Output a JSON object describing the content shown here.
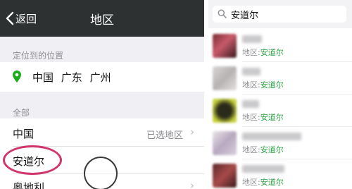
{
  "left_screen": {
    "nav": {
      "back_label": "返回",
      "title": "地区"
    },
    "location_header": "定位到的位置",
    "location": {
      "country": "中国",
      "province": "广东",
      "city": "广州"
    },
    "all_header": "全部",
    "regions": [
      {
        "label": "中国",
        "status": "已选地区"
      },
      {
        "label": "安道尔",
        "status": ""
      },
      {
        "label": "奥地利",
        "status": ""
      }
    ],
    "colors": {
      "navbar": "#2e3132",
      "location_pin": "#1aad19",
      "highlight": "#d0366e"
    }
  },
  "right_screen": {
    "search": {
      "query": "安道尔"
    },
    "results": [
      {
        "region_label": "地区:",
        "region_value": "安道尔"
      },
      {
        "region_label": "地区:",
        "region_value": "安道尔"
      },
      {
        "region_label": "地区:",
        "region_value": "安道尔"
      },
      {
        "region_label": "地区:",
        "region_value": "安道尔"
      },
      {
        "region_label": "地区:",
        "region_value": "安道尔"
      }
    ],
    "colors": {
      "match_highlight": "#2ba245"
    }
  }
}
